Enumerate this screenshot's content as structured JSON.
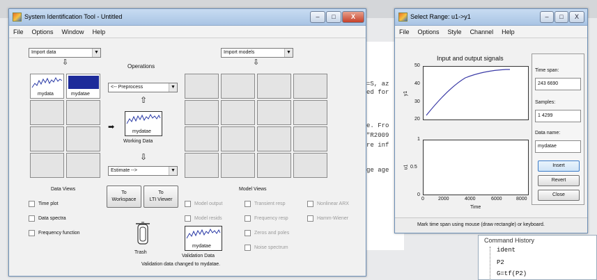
{
  "background": {
    "code_lines": [
      "=S, az",
      "ed for",
      "e. Fro",
      "\"R2009",
      "re inf",
      "ge age"
    ],
    "history_title": "Command History",
    "history_items": [
      "ident",
      "P2",
      "G=tf(P2)"
    ]
  },
  "main_window": {
    "title": "System Identification Tool - Untitled",
    "controls": {
      "minimize": "–",
      "maximize": "□",
      "close": "X"
    },
    "menu": [
      "File",
      "Options",
      "Window",
      "Help"
    ],
    "import_data": "Import data",
    "import_models": "Import models",
    "operations": "Operations",
    "preprocess": "<-- Preprocess",
    "estimate": "Estimate -->",
    "data_boards": [
      "mydata",
      "mydatae"
    ],
    "working_data_label": "mydatae",
    "working_data_caption": "Working Data",
    "data_views_title": "Data Views",
    "data_views": [
      "Time plot",
      "Data spectra",
      "Frequency function"
    ],
    "to_workspace": [
      "To",
      "Workspace"
    ],
    "to_ltiviewer": [
      "To",
      "LTI Viewer"
    ],
    "model_views_title": "Model Views",
    "model_views": [
      "Model output",
      "Transient resp",
      "Nonlinear ARX",
      "Model resids",
      "Frequency resp",
      "Hamm-Wiener",
      "Zeros and poles",
      "Noise spectrum"
    ],
    "trash": "Trash",
    "validation_label": "mydatae",
    "validation_caption": "Validation Data",
    "status": "Validation data changed to mydatae."
  },
  "range_window": {
    "title": "Select Range: u1->y1",
    "controls": {
      "minimize": "–",
      "maximize": "□",
      "close": "X"
    },
    "menu": [
      "File",
      "Options",
      "Style",
      "Channel",
      "Help"
    ],
    "plot_title": "Input and output signals",
    "y1_label": "y1",
    "u1_label": "u1",
    "x_label": "Time",
    "y1_ticks": [
      "50",
      "40",
      "30",
      "20"
    ],
    "u1_ticks": [
      "1",
      "0.5",
      "0"
    ],
    "x_ticks": [
      "0",
      "2000",
      "4000",
      "6000",
      "8000"
    ],
    "time_span_label": "Time span:",
    "time_span_value": "243 6690",
    "samples_label": "Samples:",
    "samples_value": "1 4299",
    "data_name_label": "Data name:",
    "data_name_value": "mydatae",
    "insert": "Insert",
    "revert": "Revert",
    "close": "Close",
    "status": "Mark time span using mouse (draw rectangle) or keyboard."
  }
}
